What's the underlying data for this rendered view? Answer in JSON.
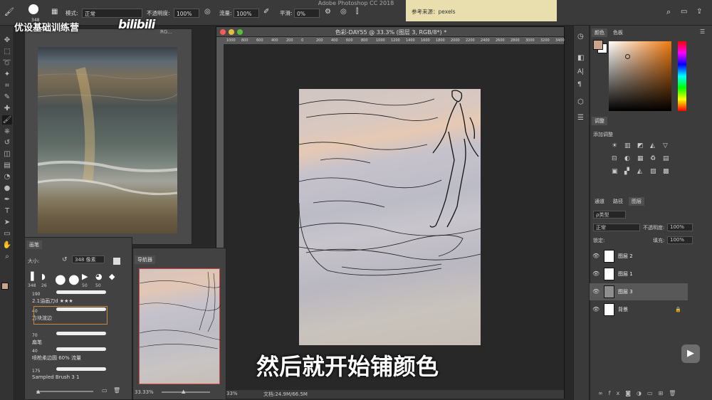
{
  "app_title": "Adobe Photoshop CC 2018",
  "options_bar": {
    "brush_size": "348",
    "mode_label": "模式:",
    "mode_value": "正常",
    "opacity_label": "不透明度:",
    "opacity_value": "100%",
    "flow_label": "流量:",
    "flow_value": "100%",
    "smoothing_label": "平滑:",
    "smoothing_value": "0%"
  },
  "reference_note": "参考来源：pexels",
  "watermark": {
    "text": "优设基础训练营",
    "logo": "bilibili"
  },
  "reference_window_title": "RG...",
  "document": {
    "title": "色彩-DAY55 @ 33.3% (图层 3, RGB/8*) *",
    "ruler_ticks": [
      "1000",
      "800",
      "600",
      "400",
      "200",
      "0",
      "200",
      "400",
      "600",
      "800",
      "1000",
      "1200",
      "1400",
      "1600",
      "1800",
      "2000",
      "2200",
      "2400",
      "2600",
      "2800",
      "3000",
      "3200",
      "3400"
    ],
    "zoom": "33%",
    "doc_size": "文档:24.9M/66.5M"
  },
  "brush_panel": {
    "tab": "画笔",
    "size_label": "大小:",
    "size_value": "348 像素",
    "preset_sizes": [
      "348",
      "26",
      "",
      "",
      "50",
      "50",
      ""
    ],
    "brushes": [
      {
        "size": "190",
        "name": "2.1油画刀d ★★★"
      },
      {
        "size": "40",
        "name": "方块渲边"
      },
      {
        "size": "70",
        "name": "扁笔"
      },
      {
        "size": "40",
        "name": "喷枪柔边圆 60% 流量"
      },
      {
        "size": "175",
        "name": "Sampled Brush 3 1"
      }
    ]
  },
  "navigator_panel": {
    "tab": "导航器",
    "zoom": "33.33%"
  },
  "color_panel": {
    "tabs": [
      "颜色",
      "色板"
    ],
    "foreground_color": "#c9a58e",
    "background_color": "#ffffff"
  },
  "adjustments_panel": {
    "tab": "调整",
    "add_label": "添加调整"
  },
  "layers_panel": {
    "tabs": [
      "通道",
      "路径",
      "图层"
    ],
    "kind_filter": "ρ类型",
    "blend_mode": "正常",
    "opacity_label": "不透明度:",
    "opacity_value": "100%",
    "lock_label": "锁定:",
    "fill_label": "填充:",
    "fill_value": "100%",
    "layers": [
      {
        "name": "图层 2",
        "selected": false
      },
      {
        "name": "图层 1",
        "selected": false
      },
      {
        "name": "图层 3",
        "selected": true
      },
      {
        "name": "背景",
        "selected": false,
        "locked": true
      }
    ]
  },
  "subtitle": "然后就开始铺颜色",
  "icons": {
    "tools": [
      "move-icon",
      "marquee-icon",
      "lasso-icon",
      "magic-wand-icon",
      "crop-icon",
      "eyedropper-icon",
      "healing-icon",
      "brush-icon",
      "stamp-icon",
      "history-brush-icon",
      "eraser-icon",
      "gradient-icon",
      "blur-icon",
      "dodge-icon",
      "pen-icon",
      "type-icon",
      "path-select-icon",
      "shape-icon",
      "hand-icon",
      "zoom-icon"
    ]
  }
}
